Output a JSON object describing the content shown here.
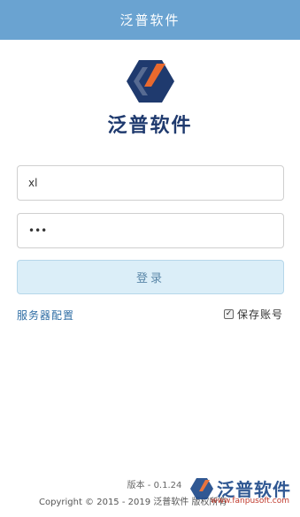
{
  "header": {
    "title": "泛普软件"
  },
  "logo": {
    "text": "泛普软件"
  },
  "login": {
    "username_value": "xl",
    "password_value": "•••",
    "submit_label": "登录"
  },
  "options": {
    "server_config_label": "服务器配置",
    "remember_label": "保存账号",
    "remember_checked": true,
    "checkmark": "✓"
  },
  "footer": {
    "version": "版本 - 0.1.24",
    "copyright": "Copyright © 2015 - 2019 泛普软件 版权所有"
  },
  "watermark": {
    "text": "泛普软件",
    "url": "www.fanpusoft.com"
  },
  "colors": {
    "header": "#6aa3d1",
    "accent": "#2e6da4",
    "logo_orange": "#e8692e",
    "logo_navy": "#1f3a6e"
  }
}
